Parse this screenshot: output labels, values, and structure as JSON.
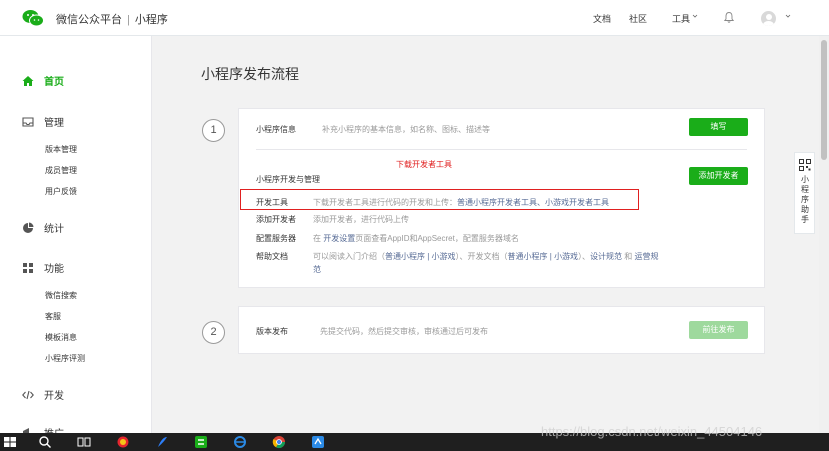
{
  "app": {
    "brand": "微信公众平台",
    "separator": "|",
    "product": "小程序"
  },
  "topnav": {
    "docs": "文档",
    "community": "社区",
    "tools": "工具"
  },
  "sidebar": {
    "home": "首页",
    "manage": "管理",
    "manage_items": [
      "版本管理",
      "成员管理",
      "用户反馈"
    ],
    "stats": "统计",
    "features": "功能",
    "feature_items": [
      "微信搜索",
      "客服",
      "模板消息",
      "小程序评测"
    ],
    "dev": "开发",
    "promote": "推广"
  },
  "main": {
    "title": "小程序发布流程",
    "step1": {
      "number": "1",
      "info_label": "小程序信息",
      "info_desc": "补充小程序的基本信息，如名称、图标、描述等",
      "fill_button": "填写",
      "dev_label": "小程序开发与管理",
      "add_dev_button": "添加开发者",
      "annotation": "下载开发者工具",
      "rows": {
        "tools_label": "开发工具",
        "tools_desc": "下载开发者工具进行代码的开发和上传：",
        "tools_link1": "普通小程序开发者工具",
        "tools_link_sep": "、",
        "tools_link2": "小游戏开发者工具",
        "add_label": "添加开发者",
        "add_desc": "添加开发者，进行代码上传",
        "server_label": "配置服务器",
        "server_prefix": "在",
        "server_link": "开发设置",
        "server_rest": "页面查看AppID和AppSecret，配置服务器域名",
        "help_label": "帮助文档",
        "help_line1_a": "可以阅读入门介绍（",
        "help_link_a1": "普通小程序",
        "help_sep1": " | ",
        "help_link_a2": "小游戏",
        "help_line1_b": "）、开发文档（",
        "help_link_b1": "普通小程序",
        "help_sep2": " | ",
        "help_link_b2": "小游戏",
        "help_line1_c": "）、",
        "help_link_c": "设计规范",
        "help_and": "和",
        "help_link_d": "运营规",
        "help_line2": "范"
      }
    },
    "step2": {
      "number": "2",
      "label": "版本发布",
      "desc": "先提交代码，然后提交审核，审核通过后可发布",
      "button": "前往发布"
    }
  },
  "helper": {
    "label": "小程序助手"
  },
  "watermark": "https://blog.csdn.net/weixin_44504146",
  "colors": {
    "accent": "#1aad19",
    "link": "#576b95",
    "annotation": "#e02020"
  }
}
